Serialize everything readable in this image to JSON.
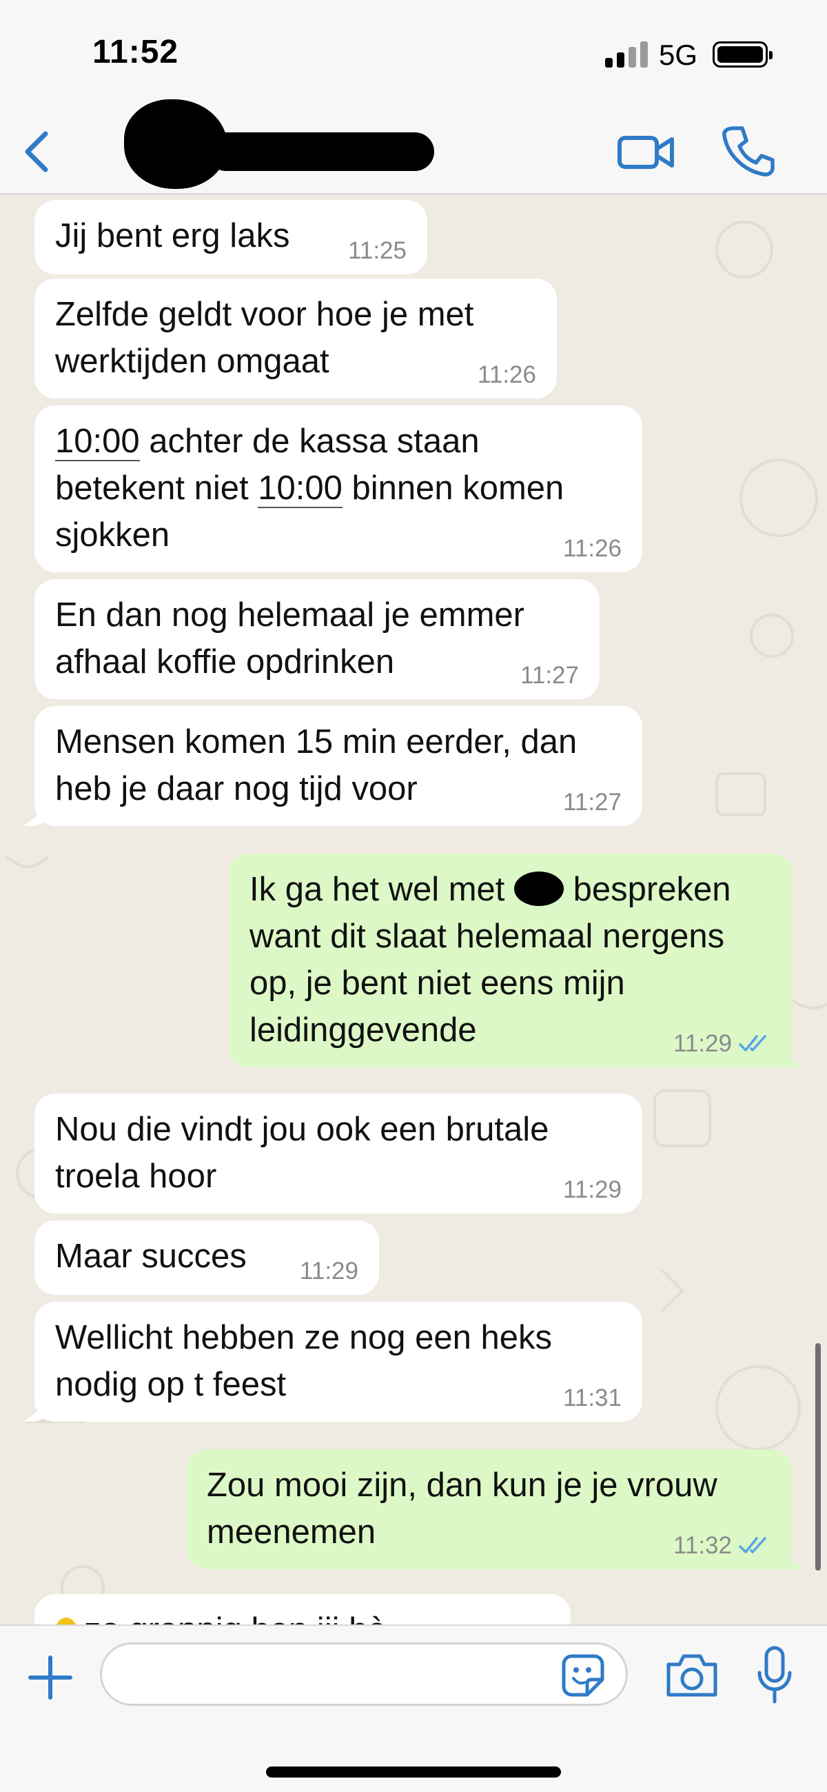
{
  "status_bar": {
    "time": "11:52",
    "network": "5G"
  },
  "header": {
    "contact_name": "",
    "back_icon": "chevron-left-icon",
    "video_icon": "video-camera-icon",
    "call_icon": "phone-icon"
  },
  "colors": {
    "accent": "#2f7bc7",
    "incoming_bubble": "#ffffff",
    "outgoing_bubble": "#dcf8c6",
    "chat_background": "#efeae2",
    "read_ticks": "#53a6e6"
  },
  "messages": [
    {
      "direction": "in",
      "text": "Jij bent erg laks",
      "time": "11:25"
    },
    {
      "direction": "in",
      "line1": "Zelfde geldt voor hoe je met",
      "line2": "werktijden omgaat",
      "time": "11:26"
    },
    {
      "direction": "in",
      "l1_u": "10:00",
      "l1_rest": " achter de kassa staan",
      "l2_a": "betekent niet ",
      "l2_u": "10:00",
      "l2_rest": " binnen komen",
      "line3": "sjokken",
      "time": "11:26"
    },
    {
      "direction": "in",
      "line1": "En dan nog helemaal je emmer",
      "line2": "afhaal koffie opdrinken",
      "time": "11:27"
    },
    {
      "direction": "in",
      "line1": "Mensen komen 15 min eerder, dan",
      "line2": "heb je daar nog tijd voor",
      "time": "11:27"
    },
    {
      "direction": "out",
      "line1_a": "Ik ga het wel met ",
      "line1_b": " bespreken",
      "line2": "want dit slaat helemaal nergens",
      "line3": "op, je bent niet eens mijn",
      "line4": "leidinggevende",
      "time": "11:29",
      "status": "read"
    },
    {
      "direction": "in",
      "line1": "Nou die vindt jou ook een brutale",
      "line2": "troela hoor",
      "time": "11:29"
    },
    {
      "direction": "in",
      "text": "Maar succes",
      "time": "11:29"
    },
    {
      "direction": "in",
      "line1": "Wellicht hebben ze nog een heks",
      "line2": "nodig op t feest",
      "time": "11:31"
    },
    {
      "direction": "out",
      "line1": "Zou mooi zijn, dan kun je je vrouw",
      "line2": "meenemen",
      "time": "11:32",
      "status": "read"
    },
    {
      "direction": "in",
      "text": "zo grappig ben jij hè",
      "partial": true
    }
  ],
  "composer": {
    "value": "",
    "plus_icon": "plus-icon",
    "sticker_icon": "sticker-icon",
    "camera_icon": "camera-icon",
    "mic_icon": "microphone-icon"
  }
}
